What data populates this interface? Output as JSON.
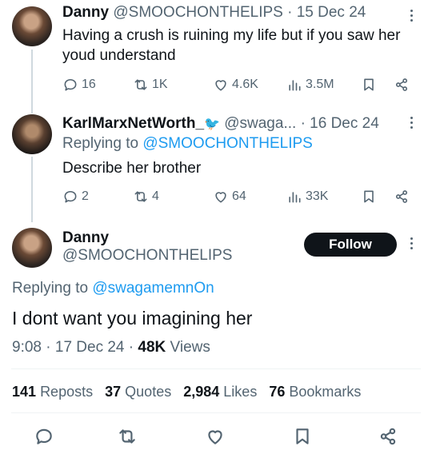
{
  "tweet1": {
    "name": "Danny",
    "handle": "@SMOOCHONTHELIPS",
    "sep": "·",
    "date": "15 Dec 24",
    "text": "Having a crush is ruining my life but if you saw her youd understand",
    "replies": "16",
    "reposts": "1K",
    "likes": "4.6K",
    "views": "3.5M"
  },
  "tweet2": {
    "name": "KarlMarxNetWorth_",
    "name_emoji": "🐦",
    "handle": "@swaga...",
    "sep": "·",
    "date": "16 Dec 24",
    "replying_prefix": "Replying to",
    "replying_to": "@SMOOCHONTHELIPS",
    "text": "Describe her brother",
    "replies": "2",
    "reposts": "4",
    "likes": "64",
    "views": "33K"
  },
  "main": {
    "name": "Danny",
    "handle": "@SMOOCHONTHELIPS",
    "follow_label": "Follow",
    "replying_prefix": "Replying to",
    "replying_to": "@swagamemnOn",
    "text": "I dont want you imagining her",
    "time": "9:08",
    "sep1": "·",
    "date": "17 Dec 24",
    "sep2": "·",
    "views_count": "48K",
    "views_label": "Views",
    "stats": [
      {
        "count": "141",
        "label": "Reposts"
      },
      {
        "count": "37",
        "label": "Quotes"
      },
      {
        "count": "2,984",
        "label": "Likes"
      },
      {
        "count": "76",
        "label": "Bookmarks"
      }
    ]
  },
  "icons": [
    "reply-icon",
    "repost-icon",
    "like-icon",
    "views-icon",
    "bookmark-icon",
    "share-icon",
    "more-icon"
  ],
  "colors": {
    "link": "#1d9bf0",
    "muted": "#536471",
    "text": "#0f1419",
    "follow_bg": "#0f1419"
  }
}
